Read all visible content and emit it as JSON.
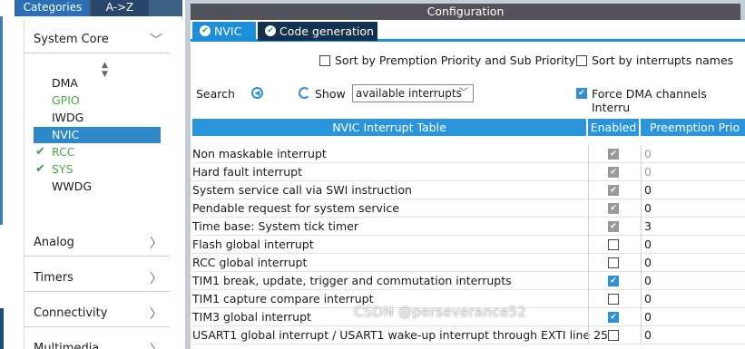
{
  "categories": {
    "tabs": [
      "Categories",
      "A->Z"
    ],
    "groups": {
      "system_core": "System Core",
      "analog": "Analog",
      "timers": "Timers",
      "connectivity": "Connectivity",
      "multimedia": "Multimedia"
    },
    "items": [
      {
        "label": "DMA",
        "state": "normal"
      },
      {
        "label": "GPIO",
        "state": "green"
      },
      {
        "label": "IWDG",
        "state": "normal"
      },
      {
        "label": "NVIC",
        "state": "selected"
      },
      {
        "label": "RCC",
        "state": "checked"
      },
      {
        "label": "SYS",
        "state": "checked"
      },
      {
        "label": "WWDG",
        "state": "normal"
      }
    ]
  },
  "config": {
    "title": "Configuration",
    "tabs": [
      "NVIC",
      "Code generation"
    ],
    "sort_priority_label": "Sort by Premption Priority and Sub Priority",
    "sort_names_label": "Sort by interrupts names",
    "search_label": "Search",
    "show_label": "Show",
    "show_value": "available interrupts",
    "force_dma_label": "Force DMA channels Interru",
    "table": {
      "headers": [
        "NVIC Interrupt Table",
        "Enabled",
        "Preemption Prio"
      ],
      "rows": [
        {
          "name": "Non maskable interrupt",
          "enabled": true,
          "locked": true,
          "preemption": "0"
        },
        {
          "name": "Hard fault interrupt",
          "enabled": true,
          "locked": true,
          "preemption": "0"
        },
        {
          "name": "System service call via SWI instruction",
          "enabled": true,
          "locked": true,
          "preemption": "0"
        },
        {
          "name": "Pendable request for system service",
          "enabled": true,
          "locked": true,
          "preemption": "0"
        },
        {
          "name": "Time base: System tick timer",
          "enabled": true,
          "locked": true,
          "preemption": "3"
        },
        {
          "name": "Flash global interrupt",
          "enabled": false,
          "locked": false,
          "preemption": "0"
        },
        {
          "name": "RCC global interrupt",
          "enabled": false,
          "locked": false,
          "preemption": "0"
        },
        {
          "name": "TIM1 break, update, trigger and commutation interrupts",
          "enabled": true,
          "locked": false,
          "preemption": "0"
        },
        {
          "name": "TIM1 capture compare interrupt",
          "enabled": false,
          "locked": false,
          "preemption": "0"
        },
        {
          "name": "TIM3 global interrupt",
          "enabled": true,
          "locked": false,
          "preemption": "0"
        },
        {
          "name": "USART1 global interrupt / USART1 wake-up interrupt through EXTI line 25",
          "enabled": false,
          "locked": false,
          "preemption": "0"
        }
      ]
    }
  },
  "watermark": "CSDN @perseverance52"
}
